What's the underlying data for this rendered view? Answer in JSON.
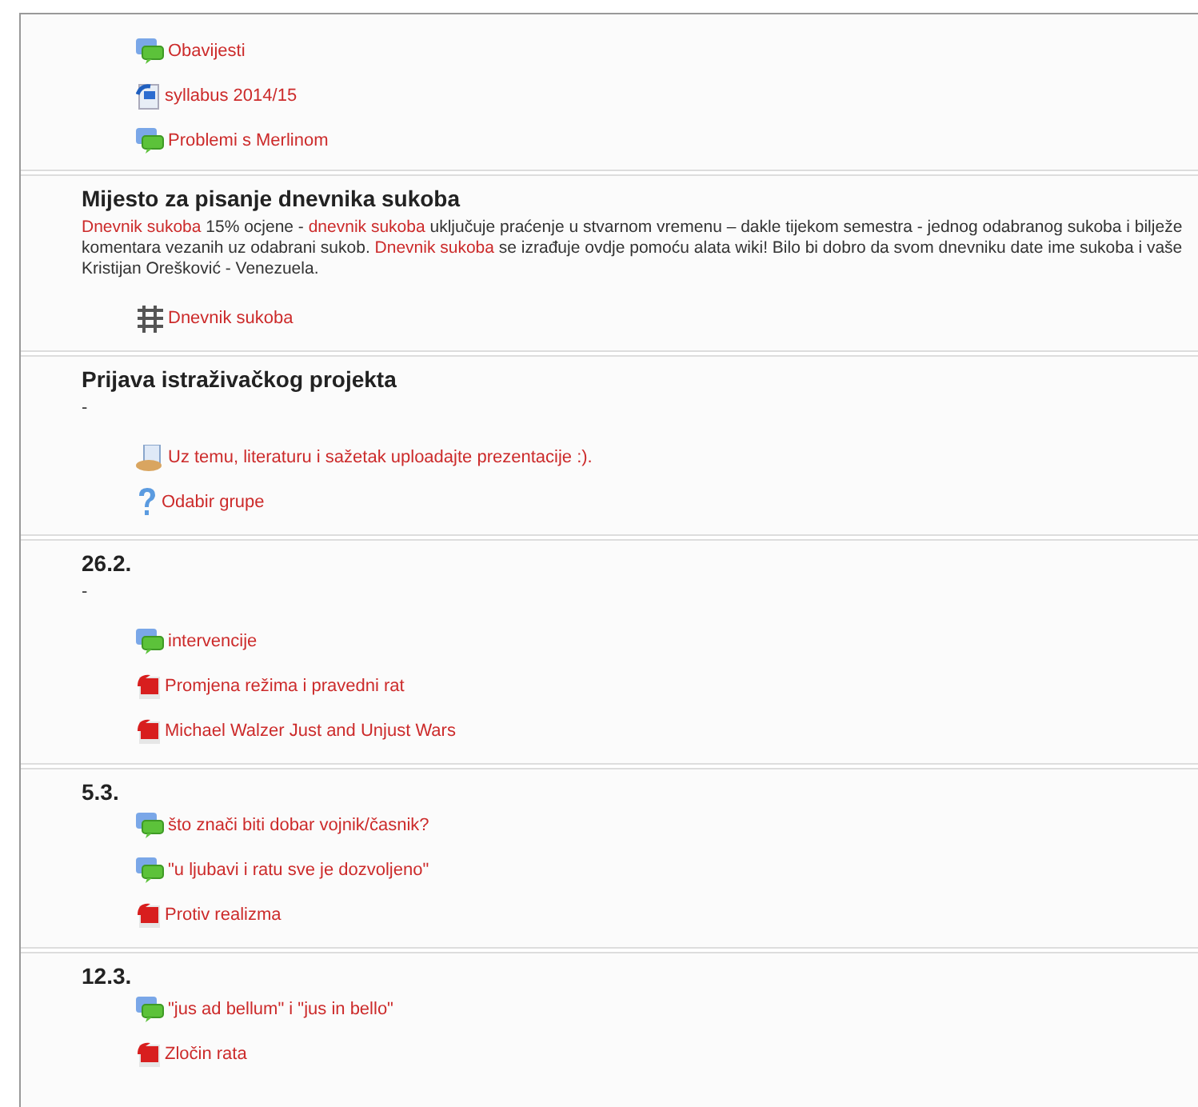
{
  "sections": [
    {
      "items": [
        {
          "kind": "forum",
          "label": "Obavijesti"
        },
        {
          "kind": "word",
          "label": "syllabus 2014/15"
        },
        {
          "kind": "forum",
          "label": "Problemi s Merlinom"
        }
      ]
    },
    {
      "title": "Mijesto za pisanje dnevnika sukoba",
      "summary_lines": [
        [
          {
            "kind": "link",
            "text": "Dnevnik sukoba"
          },
          {
            "kind": "text",
            "text": " 15% ocjene - "
          },
          {
            "kind": "link",
            "text": "dnevnik sukoba"
          },
          {
            "kind": "text",
            "text": " uključuje praćenje u stvarnom vremenu – dakle tijekom semestra - jednog odabranog sukoba i bilježe"
          }
        ],
        [
          {
            "kind": "text",
            "text": "komentara vezanih uz odabrani sukob. "
          },
          {
            "kind": "link",
            "text": "Dnevnik sukoba"
          },
          {
            "kind": "text",
            "text": " se izrađuje ovdje pomoću alata wiki! Bilo bi dobro da svom dnevniku date ime sukoba i vaše"
          }
        ],
        [
          {
            "kind": "text",
            "text": "Kristijan Orešković - Venezuela."
          }
        ]
      ],
      "items": [
        {
          "kind": "wiki",
          "label": "Dnevnik sukoba"
        }
      ]
    },
    {
      "title": "Prijava istraživačkog projekta",
      "summary": "-",
      "items": [
        {
          "kind": "assignment",
          "label": "Uz temu, literaturu i sažetak uploadajte prezentacije :)."
        },
        {
          "kind": "choice",
          "label": "Odabir grupe"
        }
      ]
    },
    {
      "title": "26.2.",
      "summary": "-",
      "items": [
        {
          "kind": "forum",
          "label": "intervencije"
        },
        {
          "kind": "pdf",
          "label": "Promjena režima i pravedni rat"
        },
        {
          "kind": "pdf",
          "label": "Michael Walzer Just and Unjust Wars"
        }
      ]
    },
    {
      "title": "5.3.",
      "items": [
        {
          "kind": "forum",
          "label": "što znači biti dobar vojnik/časnik?"
        },
        {
          "kind": "forum",
          "label": "\"u ljubavi i ratu sve je dozvoljeno\""
        },
        {
          "kind": "pdf",
          "label": "Protiv realizma"
        }
      ]
    },
    {
      "title": "12.3.",
      "items": [
        {
          "kind": "forum",
          "label": "\"jus ad bellum\" i \"jus in bello\""
        },
        {
          "kind": "pdf",
          "label": "Zločin rata"
        }
      ]
    }
  ]
}
